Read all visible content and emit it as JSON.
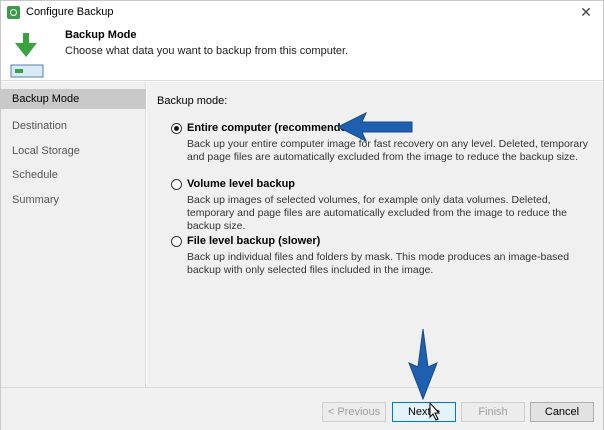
{
  "window": {
    "title": "Configure Backup",
    "close_glyph": "✕"
  },
  "header": {
    "title": "Backup Mode",
    "subtitle": "Choose what data you want to backup from this computer.",
    "icon": "download-arrow-drive-icon"
  },
  "sidebar": {
    "items": [
      {
        "label": "Backup Mode",
        "active": true
      },
      {
        "label": "Destination",
        "active": false
      },
      {
        "label": "Local Storage",
        "active": false
      },
      {
        "label": "Schedule",
        "active": false
      },
      {
        "label": "Summary",
        "active": false
      }
    ]
  },
  "main": {
    "mode_label": "Backup mode:",
    "options": [
      {
        "title": "Entire computer (recommended)",
        "description": "Back up your entire computer image for fast recovery on any level. Deleted, temporary and page files are automatically excluded from the image to reduce the backup size.",
        "selected": true
      },
      {
        "title": "Volume level backup",
        "description": "Back up images of selected volumes, for example only data volumes. Deleted, temporary and page files are automatically excluded from the image to reduce the backup size.",
        "selected": false
      },
      {
        "title": "File level backup (slower)",
        "description": "Back up individual files and folders by mask. This mode produces an image-based backup with only selected files included in the image.",
        "selected": false
      }
    ]
  },
  "footer": {
    "previous_label": "< Previous",
    "next_label": "Next >",
    "finish_label": "Finish",
    "cancel_label": "Cancel"
  },
  "colors": {
    "annotation_arrow": "#1f5fb0",
    "header_arrow": "#3aa340",
    "accent": "#0078d7"
  }
}
